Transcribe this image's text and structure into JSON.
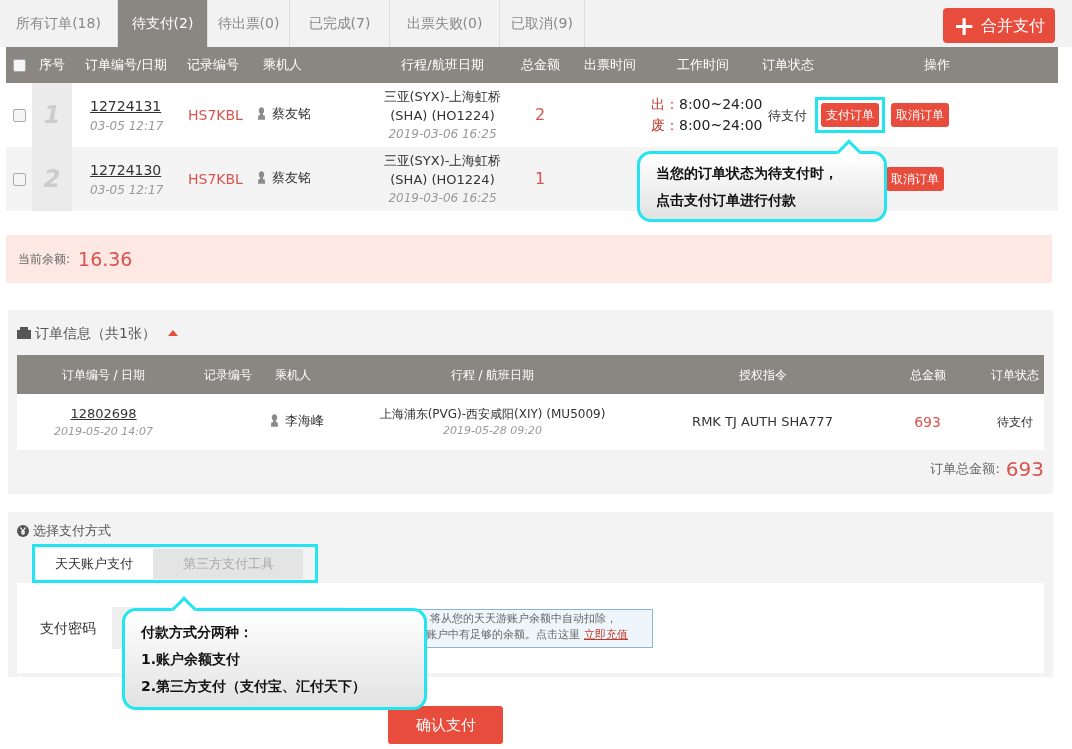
{
  "tabs": [
    {
      "label": "所有订单(18)",
      "selected": false
    },
    {
      "label": "待支付(2)",
      "selected": true
    },
    {
      "label": "待出票(0)",
      "selected": false
    },
    {
      "label": "已完成(7)",
      "selected": false
    },
    {
      "label": "出票失败(0)",
      "selected": false
    },
    {
      "label": "已取消(9)",
      "selected": false
    }
  ],
  "merge_pay_button": {
    "icon": "+",
    "label": "合并支付"
  },
  "orders": {
    "select_all_checked": false,
    "columns": [
      "序号",
      "订单编号/日期",
      "记录编号",
      "乘机人",
      "行程/航班日期",
      "总金额",
      "出票时间",
      "工作时间",
      "订单状态",
      "操作"
    ],
    "rows": [
      {
        "checked": false,
        "index": "1",
        "order_no": "12724131",
        "date": "03-05 12:17",
        "record": "HS7KBL",
        "passenger": "蔡友铭",
        "route": [
          "三亚(SYX)-上海虹桥",
          "(SHA) (HO1224)"
        ],
        "flight_date": "2019-03-06 16:25",
        "amount": "2",
        "work_hours": [
          {
            "label": "出：",
            "time": "8:00~24:00"
          },
          {
            "label": "废：",
            "time": "8:00~24:00"
          }
        ],
        "status": "待支付",
        "actions": [
          {
            "label": "支付订单",
            "highlighted": true
          },
          {
            "label": "取消订单",
            "highlighted": false
          }
        ]
      },
      {
        "checked": false,
        "index": "2",
        "order_no": "12724130",
        "date": "03-05 12:17",
        "record": "HS7KBL",
        "passenger": "蔡友铭",
        "route": [
          "三亚(SYX)-上海虹桥",
          "(SHA) (HO1224)"
        ],
        "flight_date": "2019-03-06 16:25",
        "amount": "1",
        "actions": [
          {
            "label": "取消订单",
            "highlighted": false
          }
        ]
      }
    ]
  },
  "balance": {
    "label": "当前余额:",
    "value": "16.36"
  },
  "order_info": {
    "title": "订单信息（共1张）",
    "expanded": true,
    "columns": [
      "订单编号 / 日期",
      "记录编号",
      "乘机人",
      "行程 / 航班日期",
      "授权指令",
      "总金额",
      "订单状态"
    ],
    "rows": [
      {
        "order_no": "12802698",
        "date": "2019-05-20 14:07",
        "passenger": "李海峰",
        "route": "上海浦东(PVG)-西安咸阳(XIY) (MU5009)",
        "flight_date": "2019-05-28 09:20",
        "auth": "RMK TJ AUTH SHA777",
        "amount": "693",
        "status": "待支付"
      }
    ],
    "total_label": "订单总金额:",
    "total": "693"
  },
  "payment": {
    "title": "选择支付方式",
    "highlighted": true,
    "methods": [
      {
        "label": "天天账户支付",
        "selected": true
      },
      {
        "label": "第三方支付工具",
        "selected": false
      }
    ],
    "password_label": "支付密码",
    "notice": {
      "line1": "将从您的天天游账户余额中自动扣除，",
      "line2": "账户中有足够的余额。点击这里",
      "link": "立即充值"
    },
    "confirm_button": "确认支付"
  },
  "callouts": [
    {
      "lines": [
        "当您的订单状态为待支付时，",
        "点击支付订单进行付款"
      ]
    },
    {
      "lines": [
        "付款方式分两种：",
        "1.账户余额支付",
        "2.第三方支付（支付宝、汇付天下）"
      ]
    }
  ]
}
